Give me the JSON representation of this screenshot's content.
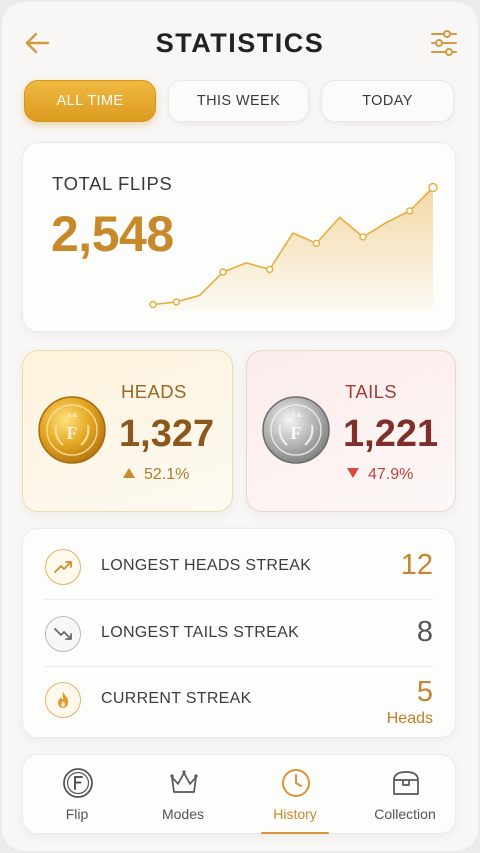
{
  "header": {
    "title": "STATISTICS",
    "back_icon": "arrow-left-icon",
    "filter_icon": "sliders-icon"
  },
  "tabs": [
    {
      "label": "ALL TIME",
      "active": true
    },
    {
      "label": "THIS WEEK",
      "active": false
    },
    {
      "label": "TODAY",
      "active": false
    }
  ],
  "total": {
    "label": "TOTAL FLIPS",
    "value": "2,548"
  },
  "chart_data": {
    "type": "area",
    "x": [
      0,
      1,
      2,
      3,
      4,
      5,
      6,
      7,
      8,
      9,
      10,
      11,
      12
    ],
    "values": [
      5,
      7,
      12,
      30,
      37,
      32,
      60,
      52,
      72,
      57,
      68,
      77,
      95
    ],
    "grid": false,
    "color": "#e6ad3c"
  },
  "heads": {
    "label": "HEADS",
    "value": "1,327",
    "change": "52.1%",
    "coin_letter": "F",
    "trend": "up"
  },
  "tails": {
    "label": "TAILS",
    "value": "1,221",
    "change": "47.9%",
    "coin_letter": "F",
    "trend": "down"
  },
  "streaks": [
    {
      "label": "LONGEST HEADS STREAK",
      "value": "12",
      "sub": "",
      "icon": "trending-up-icon",
      "color": "#c38532"
    },
    {
      "label": "LONGEST TAILS STREAK",
      "value": "8",
      "sub": "",
      "icon": "trending-down-icon",
      "color": "#555555"
    },
    {
      "label": "CURRENT STREAK",
      "value": "5",
      "sub": "Heads",
      "icon": "flame-icon",
      "color": "#c38532"
    }
  ],
  "nav": [
    {
      "label": "Flip",
      "icon": "coin-icon",
      "active": false
    },
    {
      "label": "Modes",
      "icon": "crown-icon",
      "active": false
    },
    {
      "label": "History",
      "icon": "clock-icon",
      "active": true
    },
    {
      "label": "Collection",
      "icon": "chest-icon",
      "active": false
    }
  ]
}
